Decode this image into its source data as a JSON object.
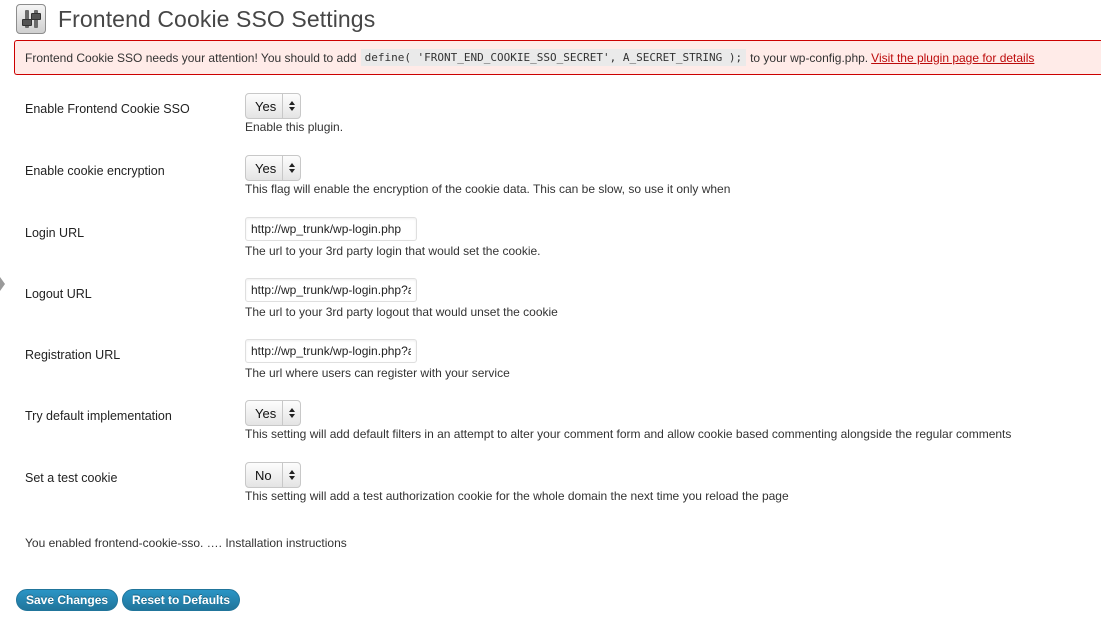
{
  "header": {
    "title": "Frontend Cookie SSO Settings",
    "icon": "settings-sliders-icon"
  },
  "notice": {
    "text_before": "Frontend Cookie SSO needs your attention! You should to add",
    "code": "define( 'FRONT_END_COOKIE_SSO_SECRET', A_SECRET_STRING );",
    "text_after": "to your wp-config.php.",
    "link_text": "Visit the plugin page for details",
    "colors": {
      "background": "#ffebe8",
      "border": "#cc0000",
      "link": "#bc0b0b"
    }
  },
  "fields": [
    {
      "label": "Enable Frontend Cookie SSO",
      "type": "select",
      "value": "Yes",
      "description": "Enable this plugin."
    },
    {
      "label": "Enable cookie encryption",
      "type": "select",
      "value": "Yes",
      "description": "This flag will enable the encryption of the cookie data. This can be slow, so use it only when"
    },
    {
      "label": "Login URL",
      "type": "text",
      "value": "http://wp_trunk/wp-login.php",
      "description": "The url to your 3rd party login that would set the cookie."
    },
    {
      "label": "Logout URL",
      "type": "text",
      "value": "http://wp_trunk/wp-login.php?a",
      "description": "The url to your 3rd party logout that would unset the cookie"
    },
    {
      "label": "Registration URL",
      "type": "text",
      "value": "http://wp_trunk/wp-login.php?a",
      "description": "The url where users can register with your service"
    },
    {
      "label": "Try default implementation",
      "type": "select",
      "value": "Yes",
      "description": "This setting will add default filters in an attempt to alter your comment form and allow cookie based commenting alongside the regular comments"
    },
    {
      "label": "Set a test cookie",
      "type": "select",
      "value": "No",
      "description": "This setting will add a test authorization cookie for the whole domain the next time you reload the page"
    }
  ],
  "info_text": "You enabled frontend-cookie-sso. …. Installation instructions",
  "buttons": {
    "save": "Save Changes",
    "reset": "Reset to Defaults",
    "color": "#21759b"
  }
}
